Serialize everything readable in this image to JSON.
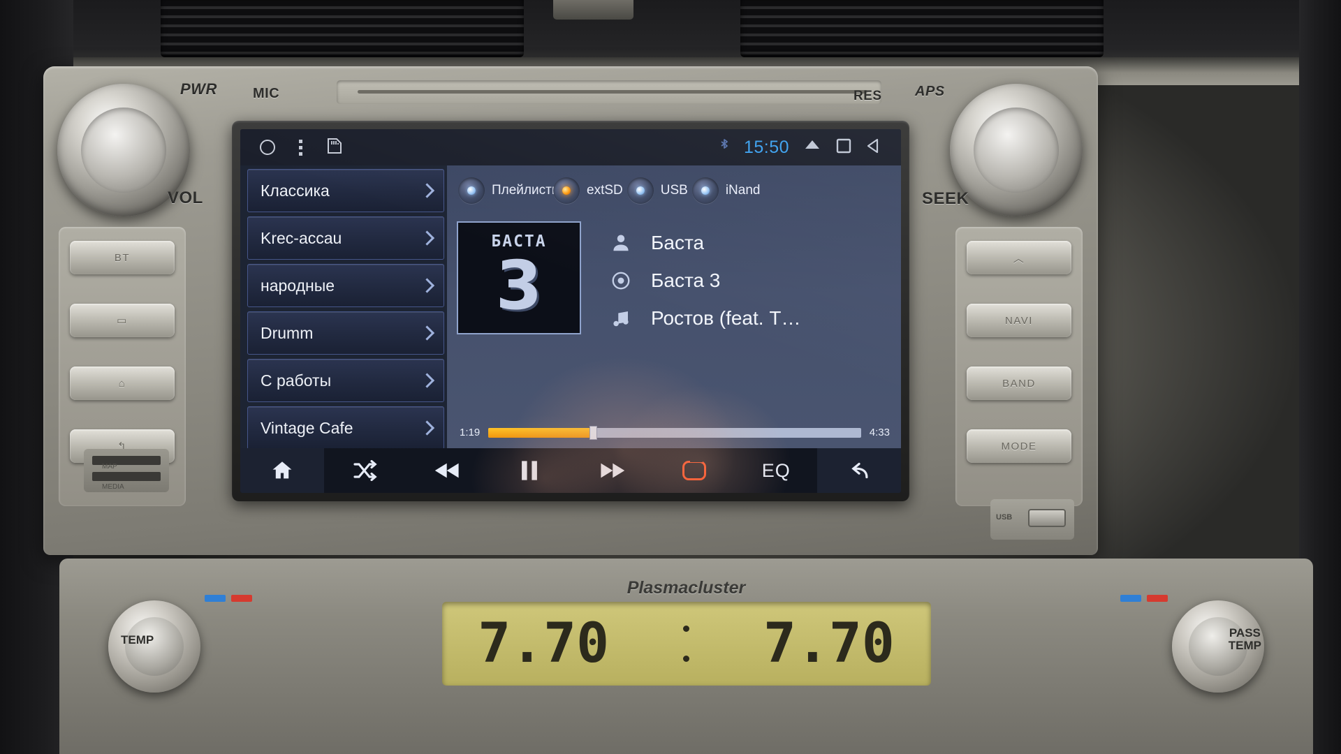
{
  "device": {
    "head_unit_labels": {
      "pwr": "PWR",
      "mic": "MIC",
      "vol": "VOL",
      "res": "RES",
      "aps": "APS",
      "seek": "SEEK",
      "usb_left_top": "MAP",
      "usb_left_bottom": "MEDIA",
      "usb_right": "USB"
    },
    "side_buttons_left": [
      "BT",
      "",
      "",
      ""
    ],
    "side_buttons_right": [
      "",
      "NAVI",
      "BAND",
      "MODE"
    ]
  },
  "statusbar": {
    "left_icons": [
      "circle-icon",
      "overflow-menu-icon",
      "sd-card-icon"
    ],
    "bluetooth_icon": "bluetooth-icon",
    "time": "15:50",
    "right_icons": [
      "eject-icon",
      "recent-apps-icon",
      "back-icon"
    ]
  },
  "playlist": {
    "items": [
      {
        "label": "Классика"
      },
      {
        "label": "Krec-accau"
      },
      {
        "label": "народные"
      },
      {
        "label": "Drumm"
      },
      {
        "label": "С работы"
      },
      {
        "label": "Vintage Cafe"
      }
    ]
  },
  "sources": [
    {
      "label": "Плейлисты",
      "selected": false
    },
    {
      "label": "extSD",
      "selected": true
    },
    {
      "label": "USB",
      "selected": false
    },
    {
      "label": "iNand",
      "selected": false
    }
  ],
  "now_playing": {
    "album_art": {
      "word": "БАСТА",
      "number": "3"
    },
    "artist": "Баста",
    "album": "Баста 3",
    "title": "Ростов (feat. Т…",
    "elapsed": "1:19",
    "duration": "4:33",
    "progress_percent": 28
  },
  "transport": {
    "home_label": "home-icon",
    "shuffle_label": "shuffle-icon",
    "prev_label": "previous-track-icon",
    "pause_label": "pause-icon",
    "next_label": "next-track-icon",
    "repeat_label": "repeat-icon",
    "eq_label": "EQ",
    "back_label": "back-arrow-icon"
  },
  "climate": {
    "brand": "Plasmacluster",
    "left_temp": "7.70",
    "right_temp": "7.70",
    "left_knob_label": "TEMP",
    "right_knob_label": "PASS\nTEMP"
  },
  "colors": {
    "accent_blue": "#3ba0ef",
    "progress_orange": "#f0960d",
    "repeat_red": "#ff4b1f",
    "led_on": "#ff9d12"
  }
}
